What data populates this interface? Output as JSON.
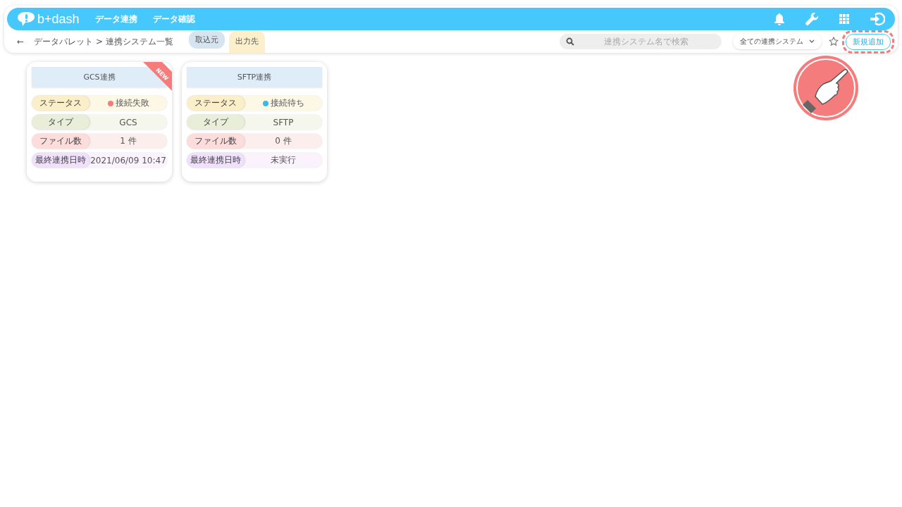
{
  "header": {
    "logo": "b+dash",
    "nav": [
      "データ連携",
      "データ確認"
    ]
  },
  "breadcrumb": {
    "back": "←",
    "path": "データパレット > 連携システム一覧"
  },
  "tabs": [
    {
      "label": "取込元",
      "selected": false
    },
    {
      "label": "出力先",
      "selected": true
    }
  ],
  "search": {
    "placeholder": "連携システム名で検索"
  },
  "filter": {
    "value": "全ての連携システム"
  },
  "add_button": {
    "label": "新規追加",
    "highlighted": true
  },
  "cards": [
    {
      "title": "GCS連携",
      "badge": "NEW",
      "rows": [
        {
          "label": "ステータス",
          "value": "接続失敗",
          "color": "#f47c7c"
        },
        {
          "label": "タイプ",
          "value": "GCS"
        },
        {
          "label": "ファイル数",
          "value": "1 件"
        },
        {
          "label": "最終連携日時",
          "value": "2021/06/09 10:47"
        }
      ]
    },
    {
      "title": "SFTP連携",
      "rows": [
        {
          "label": "ステータス",
          "value": "接続待ち",
          "color": "#3ab8e8"
        },
        {
          "label": "タイプ",
          "value": "SFTP"
        },
        {
          "label": "ファイル数",
          "value": "0 件"
        },
        {
          "label": "最終連携日時",
          "value": "未実行"
        }
      ]
    }
  ]
}
